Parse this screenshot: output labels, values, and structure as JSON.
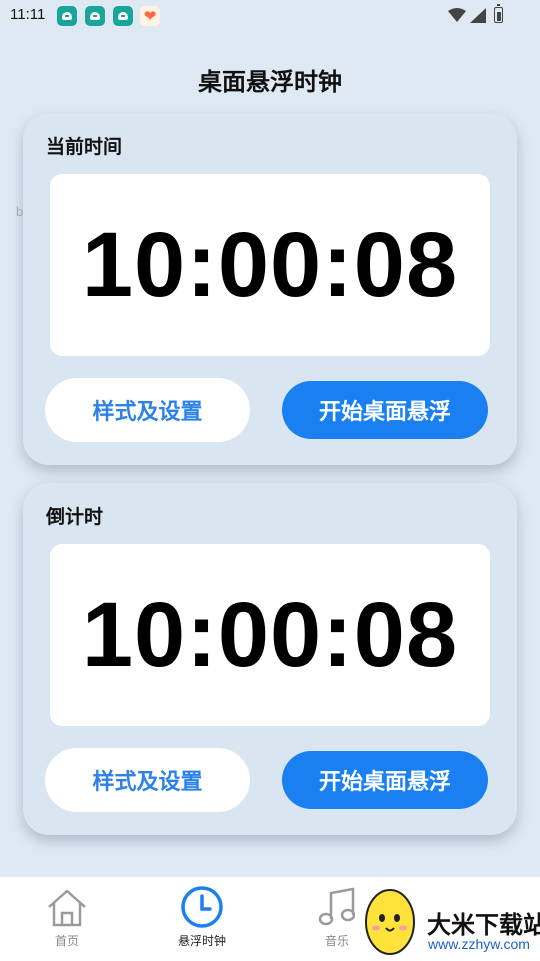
{
  "status_bar": {
    "time": "11:11",
    "icons": [
      "app-notification-icon",
      "app-notification-icon",
      "app-notification-icon",
      "heart-app-icon",
      "wifi-icon",
      "signal-icon",
      "battery-icon"
    ]
  },
  "page_title": "桌面悬浮时钟",
  "watermark": "bee471",
  "cards": [
    {
      "label": "当前时间",
      "time": "10:00:08",
      "settings_label": "样式及设置",
      "start_label": "开始桌面悬浮"
    },
    {
      "label": "倒计时",
      "time": "10:00:08",
      "settings_label": "样式及设置",
      "start_label": "开始桌面悬浮"
    }
  ],
  "bottom_nav": {
    "items": [
      {
        "label": "首页",
        "icon": "home-icon",
        "active": false
      },
      {
        "label": "悬浮时钟",
        "icon": "clock-icon",
        "active": true
      },
      {
        "label": "音乐",
        "icon": "music-icon",
        "active": false
      }
    ],
    "active_color": "#1a80f2"
  },
  "promo": {
    "brand": "大米下载站",
    "url": "www.zzhyw.com"
  },
  "colors": {
    "background": "#dfe9f3",
    "card": "#d9e6f2",
    "accent": "#1a80f2",
    "settings_text": "#2d82e8"
  }
}
